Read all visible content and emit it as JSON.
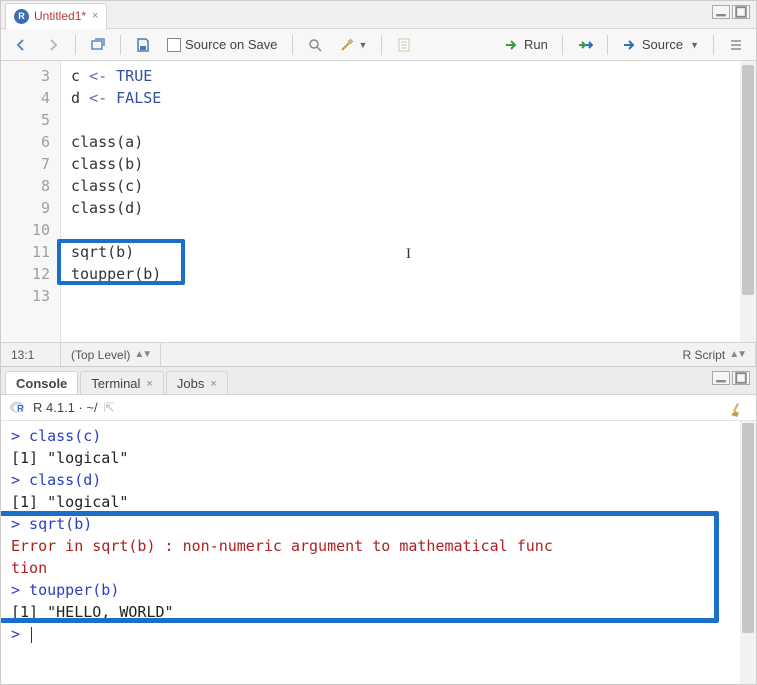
{
  "editor": {
    "tab": {
      "label": "Untitled1*",
      "icon_letter": "R"
    },
    "toolbar": {
      "source_on_save": "Source on Save",
      "run": "Run",
      "source_btn": "Source"
    },
    "lines": [
      {
        "num": 3,
        "tokens": [
          {
            "t": "c ",
            "c": "std"
          },
          {
            "t": "<-",
            "c": "op"
          },
          {
            "t": " TRUE",
            "c": "const"
          }
        ]
      },
      {
        "num": 4,
        "tokens": [
          {
            "t": "d ",
            "c": "std"
          },
          {
            "t": "<-",
            "c": "op"
          },
          {
            "t": " FALSE",
            "c": "const"
          }
        ]
      },
      {
        "num": 5,
        "tokens": []
      },
      {
        "num": 6,
        "tokens": [
          {
            "t": "class(a)",
            "c": "std"
          }
        ]
      },
      {
        "num": 7,
        "tokens": [
          {
            "t": "class(b)",
            "c": "std"
          }
        ]
      },
      {
        "num": 8,
        "tokens": [
          {
            "t": "class(c)",
            "c": "std"
          }
        ]
      },
      {
        "num": 9,
        "tokens": [
          {
            "t": "class(d)",
            "c": "std"
          }
        ]
      },
      {
        "num": 10,
        "tokens": []
      },
      {
        "num": 11,
        "tokens": [
          {
            "t": "sqrt(b)",
            "c": "std"
          }
        ]
      },
      {
        "num": 12,
        "tokens": [
          {
            "t": "toupper(b)",
            "c": "std"
          }
        ]
      },
      {
        "num": 13,
        "tokens": []
      }
    ],
    "status": {
      "pos": "13:1",
      "scope": "(Top Level)",
      "lang": "R Script"
    }
  },
  "console": {
    "tabs": [
      {
        "label": "Console",
        "active": true,
        "closable": false
      },
      {
        "label": "Terminal",
        "active": false,
        "closable": true
      },
      {
        "label": "Jobs",
        "active": false,
        "closable": true
      }
    ],
    "info": "R 4.1.1 · ~/",
    "lines": [
      {
        "kind": "in",
        "text": "> class(c)"
      },
      {
        "kind": "out",
        "text": "[1] \"logical\""
      },
      {
        "kind": "in",
        "text": "> class(d)"
      },
      {
        "kind": "out",
        "text": "[1] \"logical\""
      },
      {
        "kind": "in",
        "text": "> sqrt(b)"
      },
      {
        "kind": "err",
        "text": "Error in sqrt(b) : non-numeric argument to mathematical func"
      },
      {
        "kind": "err",
        "text": "tion"
      },
      {
        "kind": "in",
        "text": "> toupper(b)"
      },
      {
        "kind": "out",
        "text": "[1] \"HELLO, WORLD\""
      },
      {
        "kind": "prompt",
        "text": "> "
      }
    ]
  }
}
